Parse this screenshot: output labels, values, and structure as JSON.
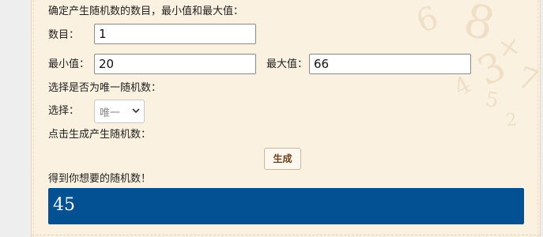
{
  "form": {
    "intro_label": "确定产生随机数的数目，最小值和最大值：",
    "count_label": "数目：",
    "count_value": "1",
    "min_label": "最小值：",
    "min_value": "20",
    "max_label": "最大值：",
    "max_value": "66",
    "unique_prompt": "选择是否为唯一随机数：",
    "select_label": "选择：",
    "select_value": "唯一",
    "generate_prompt": "点击生成产生随机数：",
    "generate_button": "生成",
    "result_label": "得到你想要的随机数！",
    "result_value": "45"
  },
  "icons": {
    "select_chevron": "chevron-down-icon"
  }
}
